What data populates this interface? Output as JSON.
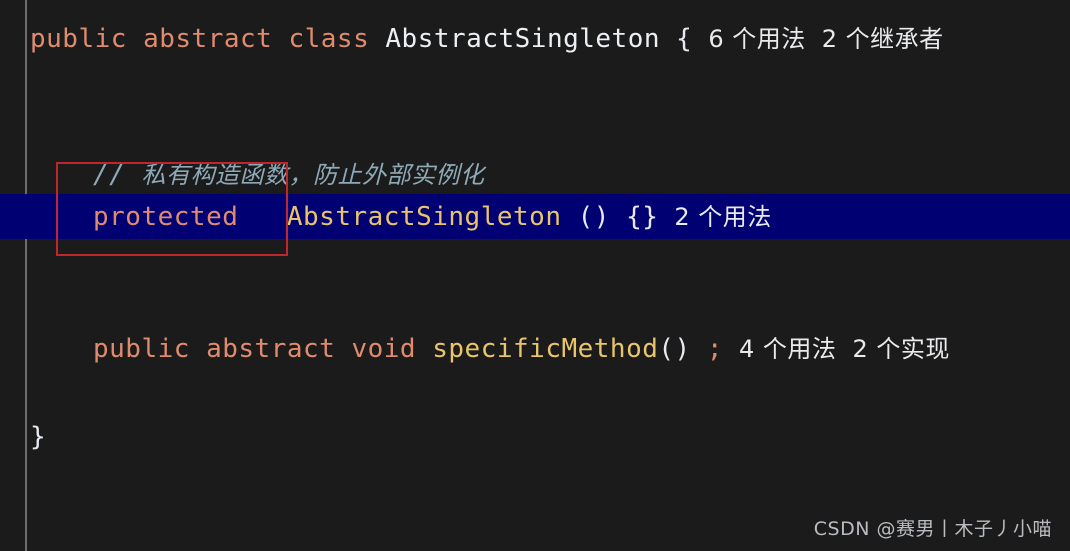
{
  "editor": {
    "background_color": "#1b1b1b",
    "highlight_color": "#000072",
    "gutter_divider_color": "#6d6d6d",
    "annotation_box_color": "#c0272d"
  },
  "code": {
    "line1": {
      "kw_public": "public",
      "sp1": " ",
      "kw_abstract": "abstract",
      "sp2": " ",
      "kw_class": "class",
      "sp3": " ",
      "class_name": "AbstractSingleton",
      "sp4": " ",
      "brace_open": "{",
      "hint_usages": "6 个用法",
      "hint_inheritors": "2 个继承者"
    },
    "comment_line": {
      "slashes": "// ",
      "text": "私有构造函数，防止外部实例化"
    },
    "constructor_line": {
      "modifier": "protected",
      "sp1": "   ",
      "name": "AbstractSingleton",
      "sp2": " ",
      "parens": "()",
      "sp3": " ",
      "body": "{}",
      "hint_usages": "2 个用法"
    },
    "method_line": {
      "kw_public": "public",
      "sp1": " ",
      "kw_abstract": "abstract",
      "sp2": " ",
      "kw_void": "void",
      "sp3": " ",
      "name": "specificMethod",
      "parens": "()",
      "sp4": " ",
      "semicolon": ";",
      "hint_usages": "4 个用法",
      "hint_implementations": "2 个实现"
    },
    "closing_line": {
      "brace_close": "}"
    }
  },
  "watermark": {
    "text": "CSDN @赛男丨木子丿小喵"
  }
}
